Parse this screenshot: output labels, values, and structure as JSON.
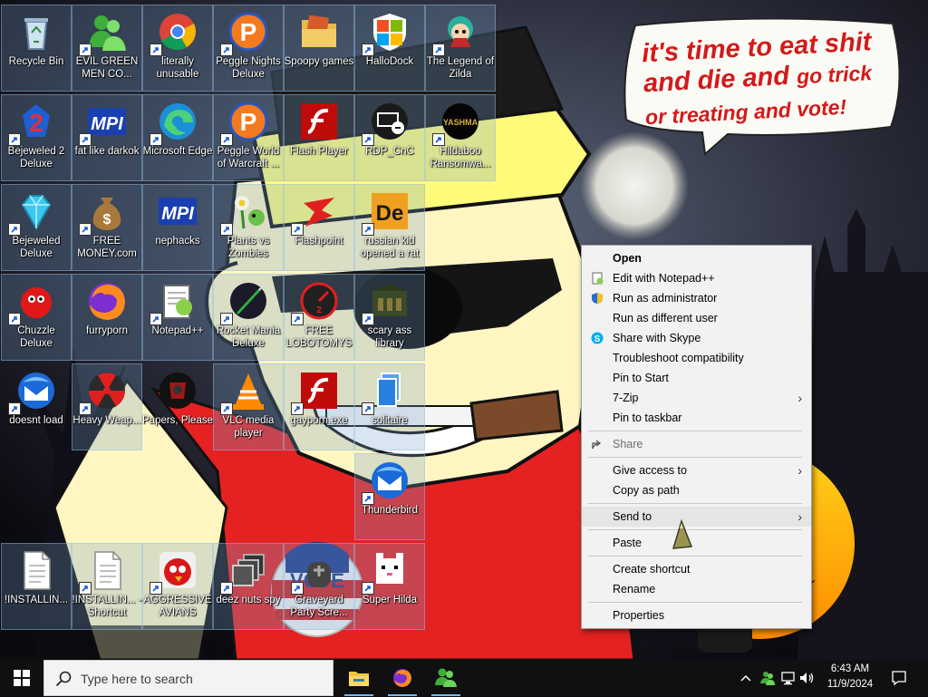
{
  "desktop": {
    "icons": [
      {
        "label": "Recycle Bin",
        "shortcut": false,
        "icon": "recycle-bin-icon"
      },
      {
        "label": "EVIL GREEN MEN CO...",
        "shortcut": true,
        "icon": "messenger-people-icon"
      },
      {
        "label": "literally unusable",
        "shortcut": true,
        "icon": "chrome-icon"
      },
      {
        "label": "Peggle Nights Deluxe",
        "shortcut": true,
        "icon": "peggle-icon"
      },
      {
        "label": "Spoopy games",
        "shortcut": false,
        "icon": "folder-icon"
      },
      {
        "label": "HalloDock",
        "shortcut": true,
        "icon": "windows-shield-icon"
      },
      {
        "label": "The Legend of Zilda",
        "shortcut": true,
        "icon": "game-character-icon"
      },
      {
        "label": "Bejeweled 2 Deluxe",
        "shortcut": true,
        "icon": "bejeweled-2-icon"
      },
      {
        "label": "fat like darkok",
        "shortcut": true,
        "icon": "mpi-icon"
      },
      {
        "label": "Microsoft Edge",
        "shortcut": true,
        "icon": "edge-icon"
      },
      {
        "label": "Peggle World of Warcraft ...",
        "shortcut": true,
        "icon": "peggle-icon"
      },
      {
        "label": "Flash Player",
        "shortcut": false,
        "icon": "flash-icon"
      },
      {
        "label": "RDP_CnC",
        "shortcut": true,
        "icon": "rdp-icon"
      },
      {
        "label": "Hildaboo Ransomwa...",
        "shortcut": true,
        "icon": "yashma-icon"
      },
      {
        "label": "Bejeweled Deluxe",
        "shortcut": true,
        "icon": "gem-icon"
      },
      {
        "label": "FREE MONEY.com",
        "shortcut": true,
        "icon": "money-bag-icon"
      },
      {
        "label": "nephacks",
        "shortcut": false,
        "icon": "mpi-icon"
      },
      {
        "label": "Plants vs Zombies",
        "shortcut": true,
        "icon": "plant-icon"
      },
      {
        "label": "Flashpoint",
        "shortcut": true,
        "icon": "flashpoint-icon"
      },
      {
        "label": "russian kid opened a rat",
        "shortcut": true,
        "icon": "de-icon"
      },
      {
        "label": "Chuzzle Deluxe",
        "shortcut": true,
        "icon": "chuzzle-icon"
      },
      {
        "label": "furryporn",
        "shortcut": false,
        "icon": "firefox-icon"
      },
      {
        "label": "Notepad++",
        "shortcut": true,
        "icon": "notepad-icon"
      },
      {
        "label": "Rocket Mania Deluxe",
        "shortcut": true,
        "icon": "rocket-icon"
      },
      {
        "label": "FREE LOBOTOMYS",
        "shortcut": true,
        "icon": "gauge-icon"
      },
      {
        "label": "scary ass library",
        "shortcut": true,
        "icon": "library-icon"
      },
      {
        "label": "doesnt load",
        "shortcut": true,
        "icon": "thunderbird-icon"
      },
      {
        "label": "Heavy Weap...",
        "shortcut": true,
        "icon": "radiation-icon"
      },
      {
        "label": "Papers, Please",
        "shortcut": false,
        "icon": "papers-please-icon"
      },
      {
        "label": "VLC media player",
        "shortcut": true,
        "icon": "vlc-icon"
      },
      {
        "label": "gayporn.exe",
        "shortcut": true,
        "icon": "flash-icon"
      },
      {
        "label": "solitaire",
        "shortcut": true,
        "icon": "cards-icon"
      },
      {
        "label": "Thunderbird",
        "shortcut": true,
        "icon": "thunderbird-icon"
      },
      {
        "label": "!INSTALLIN...",
        "shortcut": false,
        "icon": "document-icon"
      },
      {
        "label": "!INSTALLIN... - Shortcut",
        "shortcut": true,
        "icon": "document-icon"
      },
      {
        "label": "AGGRESSIVE AVIANS",
        "shortcut": true,
        "icon": "angry-bird-icon"
      },
      {
        "label": "deez nuts spy",
        "shortcut": true,
        "icon": "windows-stack-icon"
      },
      {
        "label": "Graveyard Party Scre...",
        "shortcut": true,
        "icon": "graveyard-icon"
      },
      {
        "label": "Super Hilda",
        "shortcut": true,
        "icon": "pixel-cat-icon"
      }
    ]
  },
  "wallpaper": {
    "speech_line1": "it's time to eat shit",
    "speech_line2a": "and die and ",
    "speech_line2b": "go trick",
    "speech_line3": "or treating and vote!",
    "button_text": "VOTE"
  },
  "context_menu": {
    "items": [
      {
        "label": "Open",
        "bold": true
      },
      {
        "label": "Edit with Notepad++",
        "icon": "notepad-icon"
      },
      {
        "label": "Run as administrator",
        "icon": "uac-shield-icon"
      },
      {
        "label": "Run as different user"
      },
      {
        "label": "Share with Skype",
        "icon": "skype-icon"
      },
      {
        "label": "Troubleshoot compatibility"
      },
      {
        "label": "Pin to Start"
      },
      {
        "label": "7-Zip",
        "submenu": true
      },
      {
        "label": "Pin to taskbar"
      },
      {
        "label": "Share",
        "icon": "share-icon",
        "disabled": true
      },
      {
        "label": "Give access to",
        "submenu": true
      },
      {
        "label": "Copy as path"
      },
      {
        "label": "Send to",
        "submenu": true,
        "highlighted": true
      },
      {
        "label": "Paste"
      },
      {
        "label": "Create shortcut"
      },
      {
        "label": "Rename"
      },
      {
        "label": "Properties"
      }
    ]
  },
  "taskbar": {
    "search_placeholder": "Type here to search",
    "apps": [
      "file-explorer-icon",
      "firefox-icon",
      "messenger-people-icon"
    ],
    "clock_time": "6:43 AM",
    "clock_date": "11/9/2024"
  },
  "colors": {
    "bubble_text": "#d31a1a",
    "menu_bg": "#f2f2f2",
    "taskbar_bg": "#101010",
    "accent": "#76b9ed"
  }
}
